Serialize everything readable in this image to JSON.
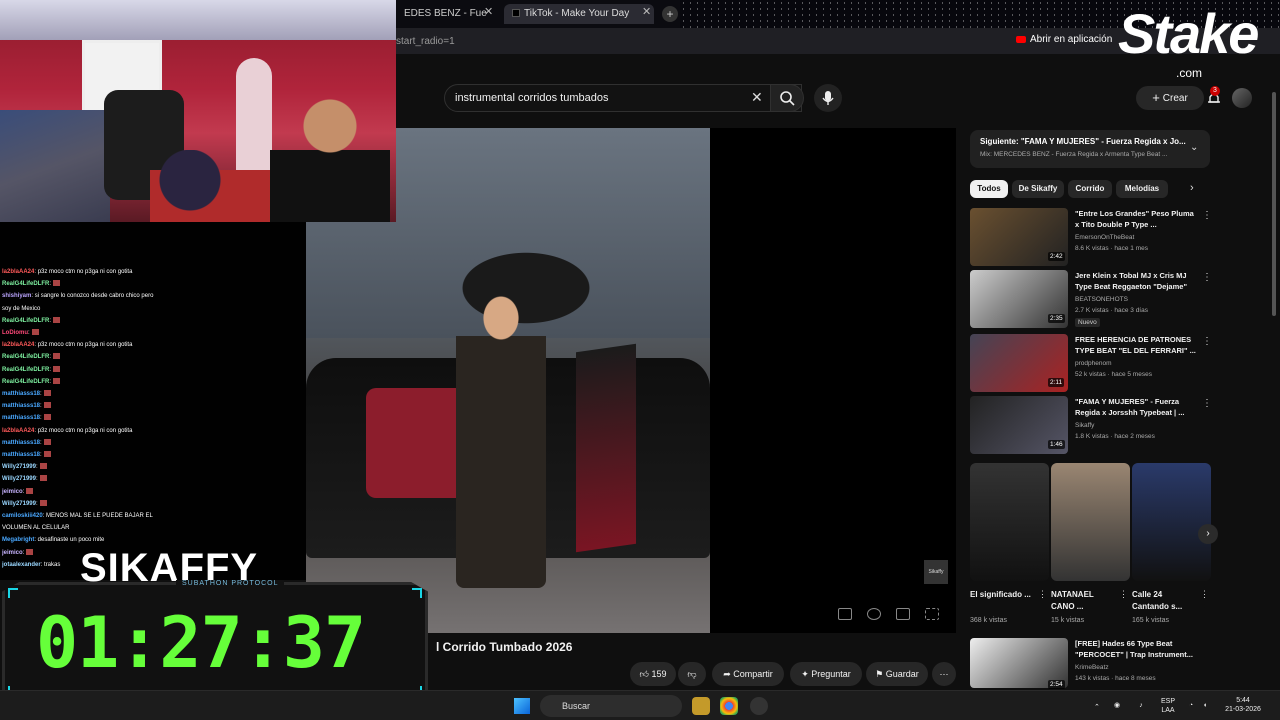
{
  "browser": {
    "tabs": [
      {
        "label": "EDES BENZ - Fue"
      },
      {
        "label": "TikTok - Make Your Day"
      }
    ],
    "url": "start_radio=1",
    "open_in_app": "Abrir en aplicación"
  },
  "youtube": {
    "search_value": "instrumental corridos tumbados",
    "create_label": "Crear",
    "notif_count": "3",
    "video_title": "l Corrido Tumbado 2026",
    "likes": "159",
    "actions": {
      "share": "Compartir",
      "ask": "Preguntar",
      "save": "Guardar"
    },
    "watermark": "Sikaffy",
    "up_next": {
      "title": "Siguiente: \"FAMA Y MUJERES\" - Fuerza Regida x Jo...",
      "subtitle": "Mix: MERCEDES BENZ - Fuerza Regida x Armenta Type Beat ..."
    },
    "chips": [
      "Todos",
      "De Sikaffy",
      "Corrido",
      "Melodías"
    ],
    "recommendations": [
      {
        "title": "\"Entre Los Grandes\" Peso Pluma x Tito Double P Type ...",
        "channel": "EmersonOnTheBeat",
        "meta": "8.6 K vistas · hace 1 mes",
        "duration": "2:42",
        "badge": ""
      },
      {
        "title": "Jere Klein x Tobal MJ x Cris MJ Type Beat Reggaeton \"Dejame\"",
        "channel": "BEATSONEHOTS",
        "meta": "2.7 K vistas · hace 3 días",
        "duration": "2:35",
        "badge": "Nuevo"
      },
      {
        "title": "FREE HERENCIA DE PATRONES TYPE BEAT \"EL DEL FERRARI\" ...",
        "channel": "prodphenom",
        "meta": "52 k vistas · hace 5 meses",
        "duration": "2:11",
        "badge": ""
      },
      {
        "title": "\"FAMA Y MUJERES\" - Fuerza Regida x Jorsshh Typebeat | ...",
        "channel": "Sikaffy",
        "meta": "1.8 K vistas · hace 2 meses",
        "duration": "1:46",
        "badge": ""
      }
    ],
    "shorts": [
      {
        "title": "El significado ...",
        "views": "368 k vistas"
      },
      {
        "title": "NATANAEL CANO ...",
        "views": "15 k vistas"
      },
      {
        "title": "Calle 24 Cantando s...",
        "views": "165 k vistas"
      }
    ],
    "last_rec": {
      "title": "[FREE] Hades 66 Type Beat \"PERCOCET\" | Trap Instrument...",
      "channel": "KrimeBeatz",
      "meta": "143 k vistas · hace 8 meses",
      "duration": "2:54"
    }
  },
  "stream": {
    "sponsor": "Stake",
    "sponsor_sub": ".com",
    "overlay_name": "SIKAFFY",
    "timer_label": "SUBATHON PROTOCOL",
    "timer": "01:27:37",
    "chat": [
      {
        "user": "la2blaAA24",
        "color": "#ff5a5a",
        "msg": ": p3z moco ctm no p3ga ni con gotita"
      },
      {
        "user": "RealG4LifeDLFR",
        "color": "#7ef0a0",
        "msg": ":"
      },
      {
        "user": "shishiyam",
        "color": "#bba5ff",
        "msg": ": si sangre lo conozco desde cabro chico pero"
      },
      {
        "user": "",
        "color": "#fff",
        "msg": "soy de Mexico"
      },
      {
        "user": "RealG4LifeDLFR",
        "color": "#7ef0a0",
        "msg": ":"
      },
      {
        "user": "LoDiomu",
        "color": "#ff4a7a",
        "msg": ":"
      },
      {
        "user": "la2blaAA24",
        "color": "#ff5a5a",
        "msg": ": p3z moco ctm no p3ga ni con gotita"
      },
      {
        "user": "RealG4LifeDLFR",
        "color": "#7ef0a0",
        "msg": ":"
      },
      {
        "user": "RealG4LifeDLFR",
        "color": "#7ef0a0",
        "msg": ":"
      },
      {
        "user": "RealG4LifeDLFR",
        "color": "#7ef0a0",
        "msg": ":"
      },
      {
        "user": "matthiasss18",
        "color": "#4aa8ff",
        "msg": ":"
      },
      {
        "user": "matthiasss18",
        "color": "#4aa8ff",
        "msg": ":"
      },
      {
        "user": "matthiasss18",
        "color": "#4aa8ff",
        "msg": ":"
      },
      {
        "user": "la2blaAA24",
        "color": "#ff5a5a",
        "msg": ": p3z moco ctm no p3ga ni con gotita"
      },
      {
        "user": "matthiasss18",
        "color": "#4aa8ff",
        "msg": ":"
      },
      {
        "user": "matthiasss18",
        "color": "#4aa8ff",
        "msg": ":"
      },
      {
        "user": "Willy271999",
        "color": "#9ad7ff",
        "msg": ":"
      },
      {
        "user": "Willy271999",
        "color": "#9ad7ff",
        "msg": ":"
      },
      {
        "user": "jeimico",
        "color": "#c8b4ff",
        "msg": ":"
      },
      {
        "user": "Willy271999",
        "color": "#9ad7ff",
        "msg": ":"
      },
      {
        "user": "camiloskiii420",
        "color": "#4aa8ff",
        "msg": ": MENOS MAL SE LE PUEDE BAJAR EL"
      },
      {
        "user": "",
        "color": "#fff",
        "msg": "VOLUMEN AL CELULAR"
      },
      {
        "user": "Megabright",
        "color": "#4aa8ff",
        "msg": ": desafinaste un poco mite"
      },
      {
        "user": "jeimico",
        "color": "#c8b4ff",
        "msg": ":"
      },
      {
        "user": "jotaalexander",
        "color": "#9ad7ff",
        "msg": ": trakas"
      }
    ]
  },
  "taskbar": {
    "search_placeholder": "Buscar",
    "lang": "ESP",
    "lang2": "LAA",
    "time": "5:44",
    "date": "21-03-2026"
  }
}
